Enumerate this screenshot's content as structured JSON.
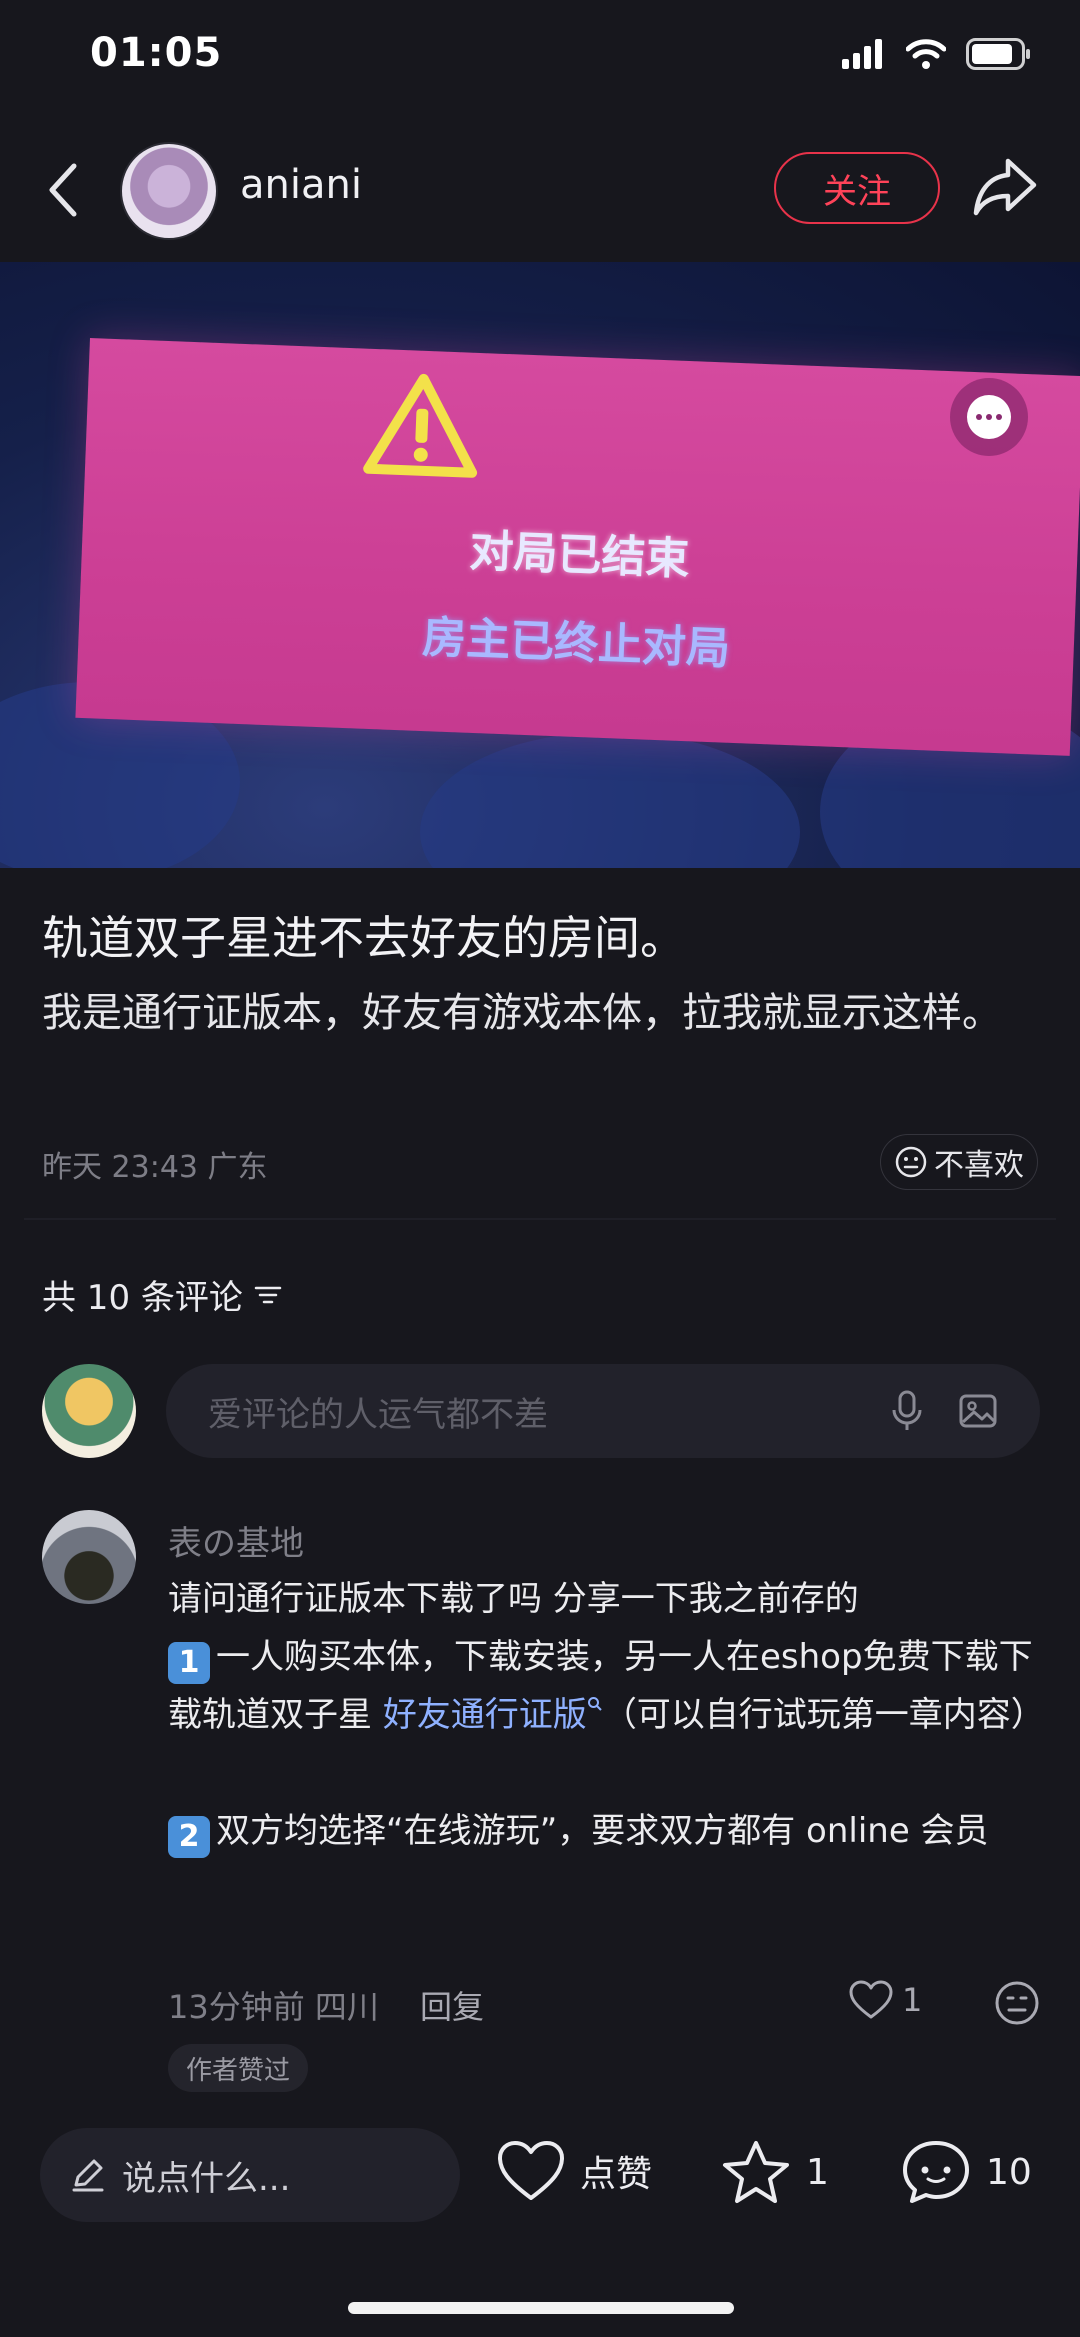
{
  "status_bar": {
    "time": "01:05"
  },
  "header": {
    "username": "aniani",
    "follow_label": "关注"
  },
  "photo": {
    "panel_line1": "对局已结束",
    "panel_line2": "房主已终止对局"
  },
  "post": {
    "title": "轨道双子星进不去好友的房间。",
    "body": "我是通行证版本，好友有游戏本体，拉我就显示这样。",
    "meta": "昨天 23:43 广东",
    "dislike_label": "不喜欢"
  },
  "comments": {
    "count_label": "共 10 条评论",
    "input_placeholder": "爱评论的人运气都不差",
    "items": [
      {
        "author": "表の基地",
        "line1": "请问通行证版本下载了吗 分享一下我之前存的",
        "keycap1": "1",
        "line2_a": "一人购买本体，下载安装，另一人在eshop免费下载下载轨道双子星",
        "line2_link": "好友通行证版",
        "line2_b": "（可以自行试玩第一章内容）",
        "keycap2": "2",
        "line3": "双方均选择“在线游玩”，要求双方都有 online 会员",
        "meta": "13分钟前 四川",
        "reply_label": "回复",
        "like_count": "1",
        "author_liked": "作者赞过"
      }
    ]
  },
  "bottom_bar": {
    "say_placeholder": "说点什么...",
    "like_label": "点赞",
    "star_count": "1",
    "comment_count": "10"
  },
  "colors": {
    "accent": "#ff4359",
    "link": "#8fb1ff",
    "background": "#17171d"
  }
}
